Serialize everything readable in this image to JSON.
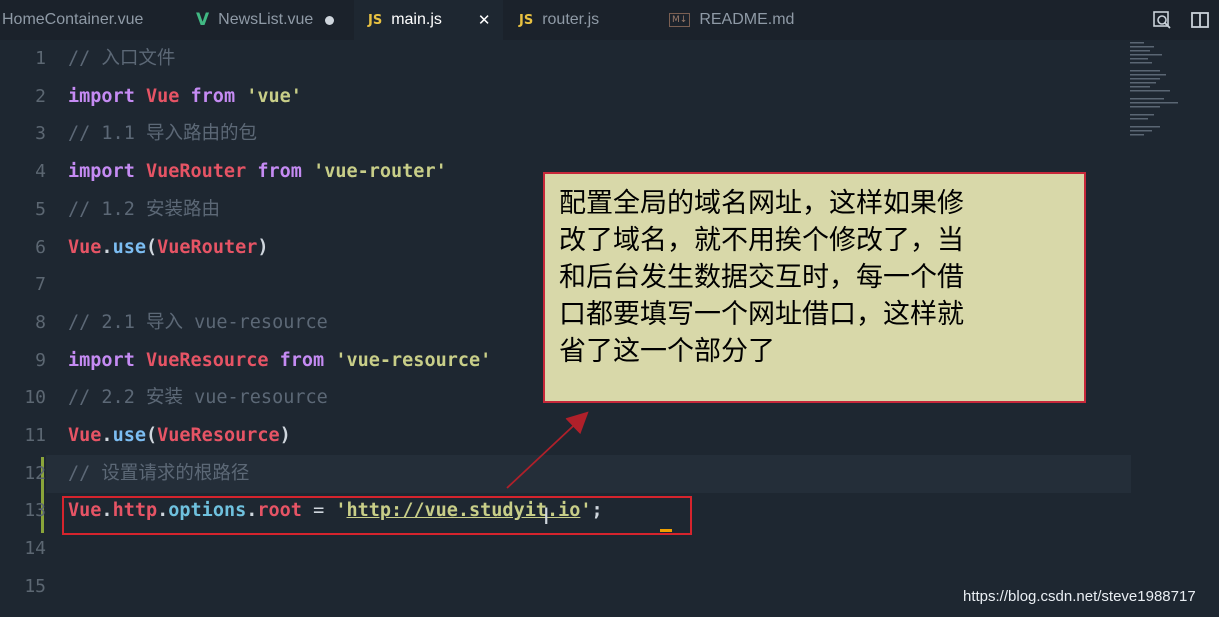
{
  "tabs": [
    {
      "label": "HomeContainer.vue",
      "icon": "none"
    },
    {
      "label": "NewsList.vue",
      "icon": "vue-icon",
      "modified": true
    },
    {
      "label": "main.js",
      "icon": "js-icon",
      "active": true
    },
    {
      "label": "router.js",
      "icon": "js-icon"
    },
    {
      "label": "README.md",
      "icon": "markdown-icon"
    }
  ],
  "icon_labels": {
    "js": "JS",
    "vue": "V",
    "md": "M↓",
    "close": "✕"
  },
  "toolbar_icons": [
    "search-preview-icon",
    "split-editor-icon"
  ],
  "lines": {
    "n": [
      "1",
      "2",
      "3",
      "4",
      "5",
      "6",
      "7",
      "8",
      "9",
      "10",
      "11",
      "12",
      "13",
      "14",
      "15"
    ],
    "l1": "// 入口文件",
    "l2": {
      "import": "import",
      "vue": "Vue",
      "from": "from",
      "str": "'vue'"
    },
    "l3": "// 1.1 导入路由的包",
    "l4": {
      "import": "import",
      "cls": "VueRouter",
      "from": "from",
      "str": "'vue-router'"
    },
    "l5": "// 1.2 安装路由",
    "l6": {
      "obj": "Vue",
      "dot": ".",
      "fn": "use",
      "open": "(",
      "arg": "VueRouter",
      "close": ")"
    },
    "l8": "// 2.1 导入 vue-resource",
    "l9": {
      "import": "import",
      "cls": "VueResource",
      "from": "from",
      "str": "'vue-resource'"
    },
    "l10": "// 2.2 安装 vue-resource",
    "l11": {
      "obj": "Vue",
      "dot": ".",
      "fn": "use",
      "open": "(",
      "arg": "VueResource",
      "close": ")"
    },
    "l12": "// 设置请求的根路径",
    "l13": {
      "vue": "Vue",
      "dot1": ".",
      "http": "http",
      "dot2": ".",
      "options": "options",
      "dot3": ".",
      "root": "root",
      "eq": " = ",
      "q1": "'",
      "url": "http://vue.studyit.io",
      "q2": "'",
      "semi": ";"
    }
  },
  "annotation": "配置全局的域名网址，这样如果修\n改了域名，就不用挨个修改了，当\n和后台发生数据交互时，每一个借\n口都要填写一个网址借口，这样就\n省了这一个部分了",
  "watermark": "https://blog.csdn.net/steve1988717",
  "colors": {
    "annotation_bg": "#d8d8a9",
    "annotation_border": "#c6283a",
    "highlight_box": "#d6242d",
    "arrow": "#b0202a"
  }
}
